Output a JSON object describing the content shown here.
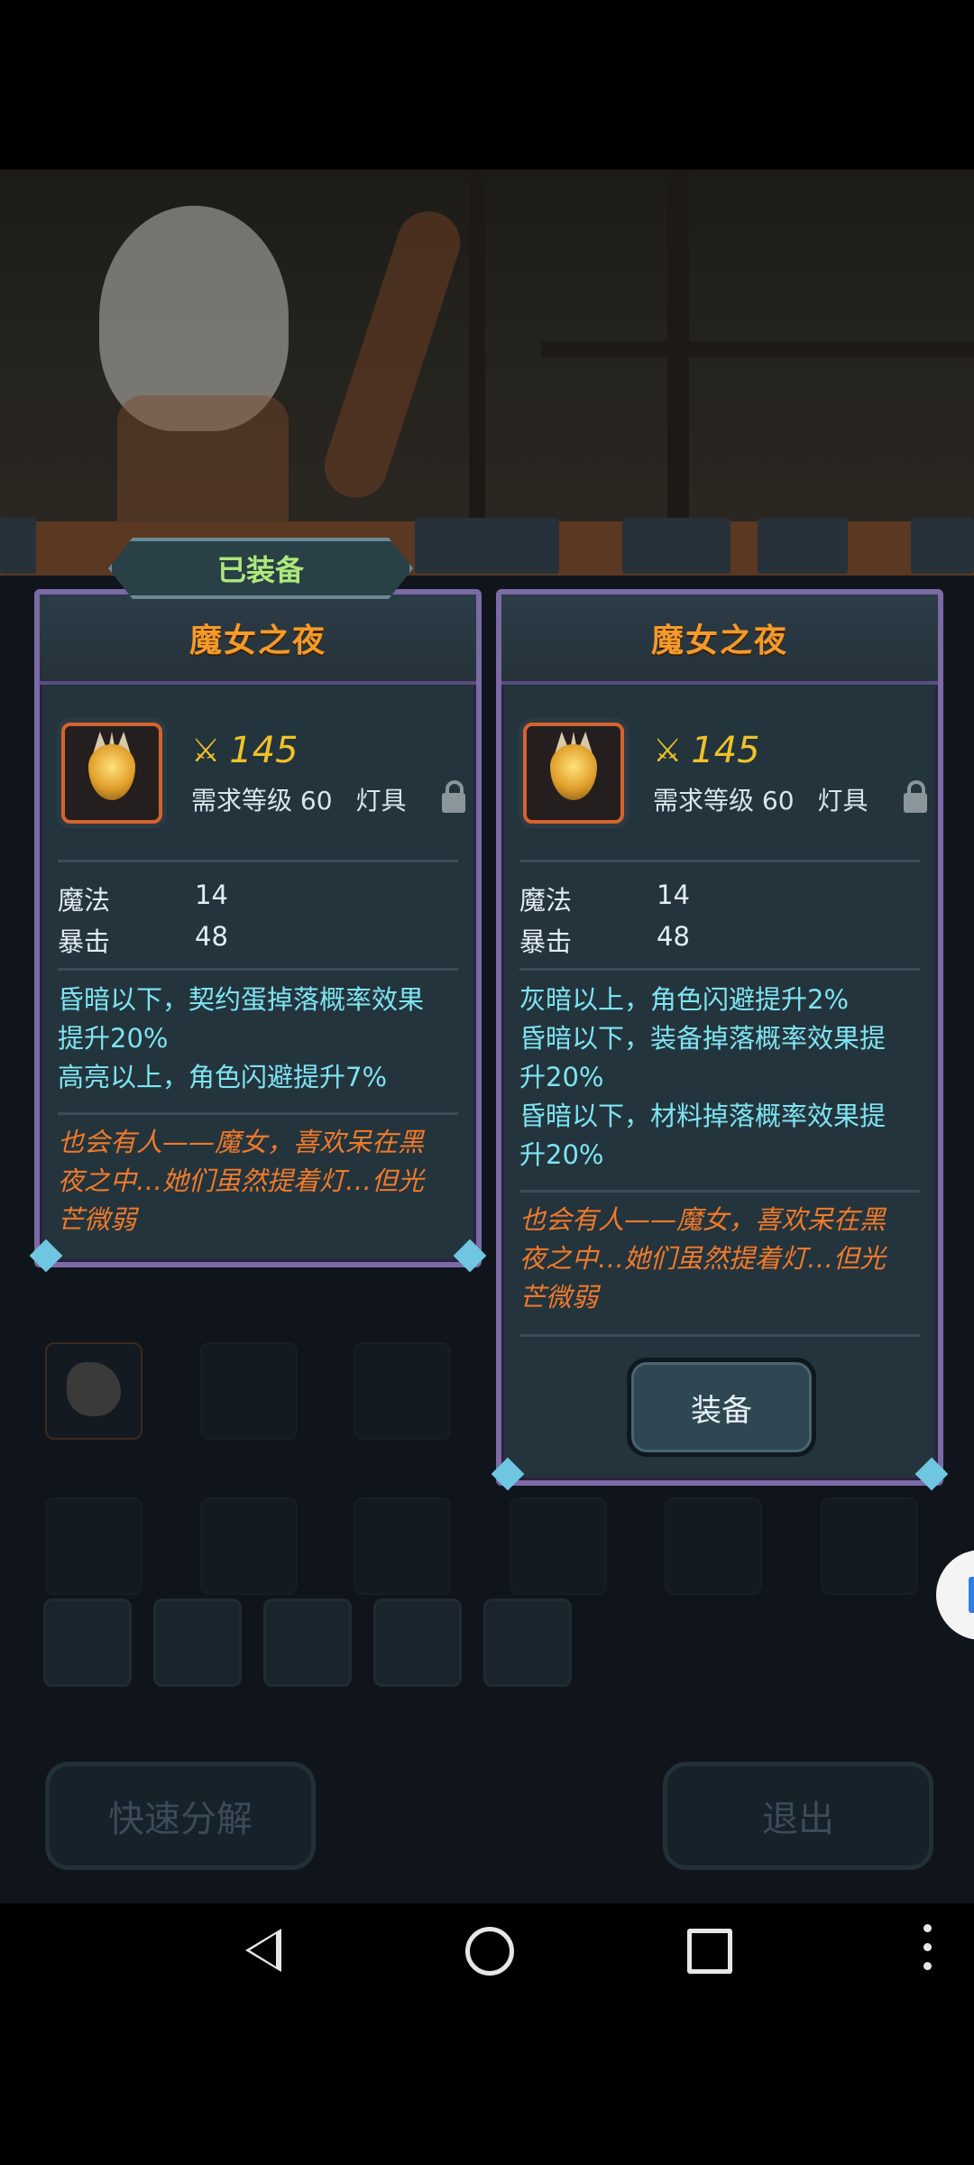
{
  "equipped_tag": "已装备",
  "left_card": {
    "title": "魔女之夜",
    "power": "145",
    "req_level": "需求等级 60",
    "slot_type": "灯具",
    "stats": [
      {
        "label": "魔法",
        "value": "14"
      },
      {
        "label": "暴击",
        "value": "48"
      }
    ],
    "effects": [
      "昏暗以下，契约蛋掉落概率效果",
      "提升20%",
      "高亮以上，角色闪避提升7%"
    ],
    "lore": [
      "也会有人——魔女，喜欢呆在黑",
      "夜之中…她们虽然提着灯…但光",
      "芒微弱"
    ]
  },
  "right_card": {
    "title": "魔女之夜",
    "power": "145",
    "req_level": "需求等级 60",
    "slot_type": "灯具",
    "stats": [
      {
        "label": "魔法",
        "value": "14"
      },
      {
        "label": "暴击",
        "value": "48"
      }
    ],
    "effects": [
      "灰暗以上，角色闪避提升2%",
      "昏暗以下，装备掉落概率效果提",
      "升20%",
      "昏暗以下，材料掉落概率效果提",
      "升20%"
    ],
    "lore": [
      "也会有人——魔女，喜欢呆在黑",
      "夜之中…她们虽然提着灯…但光",
      "芒微弱"
    ],
    "equip_button": "装备"
  },
  "background": {
    "quick_decompose": "快速分解",
    "exit": "退出"
  },
  "icons": {
    "power": "power-icon",
    "lock": "lock-icon"
  }
}
